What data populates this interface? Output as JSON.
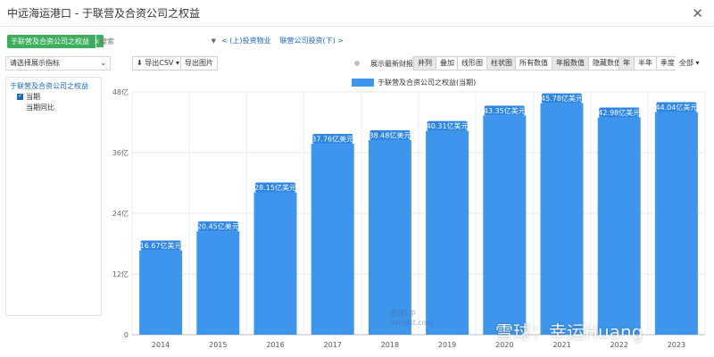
{
  "window": {
    "title": "中远海运港口 - 于联营及合资公司之权益",
    "close_glyph": "✕"
  },
  "filter": {
    "tag_label": "于联营及合资公司之权益",
    "tag_remove": "×",
    "search_placeholder": "搜索",
    "links": [
      "< (上)投资物业",
      "联营公司投资(下) >"
    ]
  },
  "toolbar": {
    "indicator_select": "请选择展示指标",
    "export_csv": "导出CSV",
    "export_image": "导出图片",
    "show_latest": "展示最新财报",
    "layout_modes": [
      "并列",
      "叠加"
    ],
    "layout_active": "并列",
    "chart_types": [
      "线形图",
      "柱状图"
    ],
    "chart_active": "柱状图",
    "value_modes": [
      "所有数值",
      "年报数值",
      "隐藏数值"
    ],
    "value_active": "年报数值",
    "periods": [
      "年",
      "半年",
      "季度"
    ],
    "period_active": "年",
    "range": "全部"
  },
  "left_panel": {
    "root": "于联营及合资公司之权益",
    "items": [
      {
        "label": "当期",
        "checked": true
      },
      {
        "label": "当期同比",
        "checked": false
      }
    ]
  },
  "watermark": {
    "main": "雪球：幸运Huang",
    "small_line1": "雪球1中",
    "small_line2": "livingst.com"
  },
  "colors": {
    "bar": "#3d95ec",
    "label_bg": "#2d86e3",
    "tag": "#3dae5c",
    "link": "#1a66c4"
  },
  "chart_data": {
    "type": "bar",
    "legend": "于联营及合资公司之权益(当期)",
    "categories": [
      "2014",
      "2015",
      "2016",
      "2017",
      "2018",
      "2019",
      "2020",
      "2021",
      "2022",
      "2023"
    ],
    "values": [
      16.67,
      20.45,
      28.15,
      37.76,
      38.48,
      40.31,
      43.35,
      45.78,
      42.98,
      44.04
    ],
    "data_labels": [
      "16.67亿美元",
      "20.45亿美元",
      "28.15亿美元",
      "37.76亿美元",
      "38.48亿美元",
      "40.31亿美元",
      "43.35亿美元",
      "45.78亿美元",
      "42.98亿美元",
      "44.04亿美元"
    ],
    "y_ticks": [
      0,
      12,
      24,
      36,
      48
    ],
    "y_tick_labels": [
      "0",
      "12亿",
      "24亿",
      "36亿",
      "48亿"
    ],
    "ylim": [
      0,
      48
    ],
    "grid": true
  }
}
